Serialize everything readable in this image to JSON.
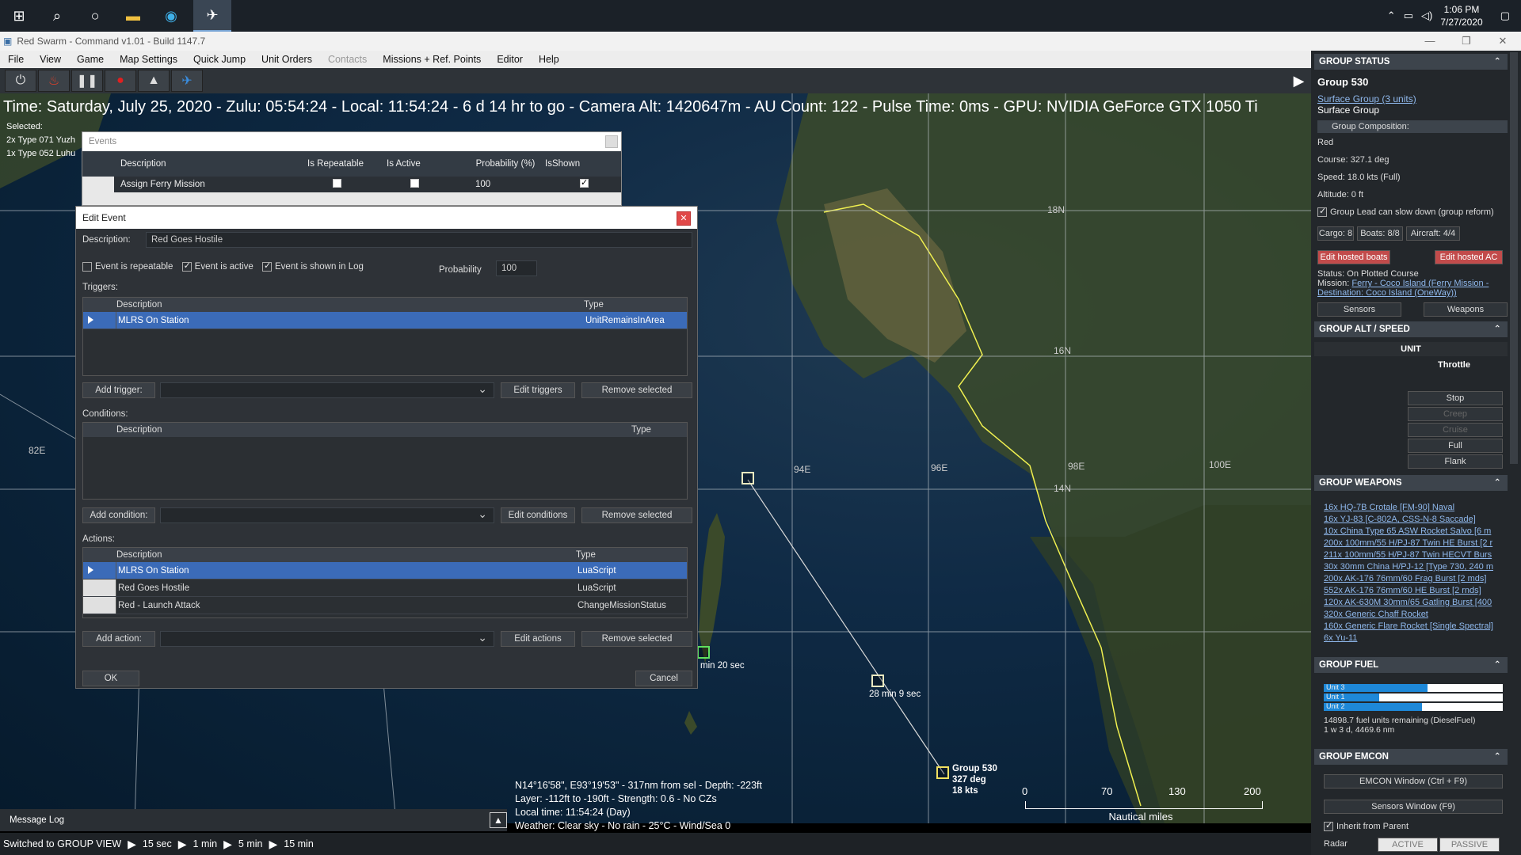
{
  "taskbar": {
    "time": "1:06 PM",
    "date": "7/27/2020"
  },
  "window": {
    "title": "Red Swarm - Command v1.01 - Build 1147.7"
  },
  "menu": [
    "File",
    "View",
    "Game",
    "Map Settings",
    "Quick Jump",
    "Unit Orders",
    "Contacts",
    "Missions + Ref. Points",
    "Editor",
    "Help"
  ],
  "infobar": "Time: Saturday, July 25, 2020 - Zulu: 05:54:24 - Local: 11:54:24 - 6 d 14 hr to go -  Camera Alt: 1420647m - AU Count: 122 - Pulse Time: 0ms - GPU: NVIDIA GeForce GTX 1050 Ti",
  "selected": {
    "label": "Selected:",
    "lines": [
      "2x Type 071 Yuzh",
      "1x Type 052 Luhu"
    ]
  },
  "map": {
    "lat_labels": [
      "18N",
      "16N",
      "14N",
      "82E",
      "94E",
      "96E",
      "98E",
      "100E"
    ],
    "unit_labels": {
      "eta1": "min 20 sec",
      "eta2": "28 min 9 sec",
      "group_name": "Group 530",
      "group_course": "327 deg",
      "group_speed": "18 kts"
    },
    "cursor_info": [
      "N14°16'58\", E93°19'53\" - 317nm from sel - Depth: -223ft",
      "Layer: -112ft to -190ft - Strength: 0.6 - No CZs",
      "Local time: 11:54:24 (Day)",
      "Weather: Clear sky - No rain - 25°C - Wind/Sea 0"
    ],
    "scale": {
      "ticks": [
        "0",
        "70",
        "130",
        "200"
      ],
      "unit": "Nautical miles"
    }
  },
  "events": {
    "title": "Events",
    "columns": [
      "Description",
      "Is Repeatable",
      "Is Active",
      "Probability (%)",
      "IsShown"
    ],
    "row": {
      "description": "Assign Ferry Mission",
      "probability": "100"
    }
  },
  "edit_event": {
    "title": "Edit Event",
    "description_label": "Description:",
    "description_value": "Red Goes Hostile",
    "repeatable_label": "Event is repeatable",
    "active_label": "Event is active",
    "shown_label": "Event is shown in Log",
    "probability_label": "Probability",
    "probability_value": "100",
    "triggers_label": "Triggers:",
    "conditions_label": "Conditions:",
    "actions_label": "Actions:",
    "col_description": "Description",
    "col_type": "Type",
    "triggers": [
      {
        "description": "MLRS On Station",
        "type": "UnitRemainsInArea"
      }
    ],
    "actions": [
      {
        "description": "MLRS On Station",
        "type": "LuaScript"
      },
      {
        "description": "Red Goes Hostile",
        "type": "LuaScript"
      },
      {
        "description": "Red - Launch Attack",
        "type": "ChangeMissionStatus"
      }
    ],
    "add_trigger": "Add trigger:",
    "edit_triggers": "Edit triggers",
    "add_condition": "Add condition:",
    "edit_conditions": "Edit conditions",
    "add_action": "Add action:",
    "edit_actions": "Edit actions",
    "remove_selected": "Remove selected",
    "ok": "OK",
    "cancel": "Cancel"
  },
  "message_log": "Message Log",
  "statusbar": {
    "text": "Switched to GROUP VIEW",
    "speeds": [
      "15 sec",
      "1 min",
      "5 min",
      "15 min"
    ]
  },
  "panel": {
    "group_status": "GROUP STATUS",
    "group_name": "Group 530",
    "surface_group_link": "Surface Group (3 units)",
    "surface_group": "Surface Group",
    "composition": "Group Composition:",
    "side": "Red",
    "course": "Course: 327.1 deg",
    "speed": "Speed: 18.0 kts (Full)",
    "altitude": "Altitude: 0 ft",
    "group_lead": "Group Lead can slow down (group reform)",
    "cargo": "Cargo: 8",
    "boats": "Boats: 8/8",
    "aircraft": "Aircraft: 4/4",
    "edit_boats": "Edit hosted boats",
    "edit_ac": "Edit hosted AC",
    "status": "Status: On Plotted Course",
    "mission_label": "Mission:",
    "mission_link": "Ferry - Coco Island (Ferry Mission - Destination: Coco Island (OneWay))",
    "sensors": "Sensors",
    "weapons": "Weapons",
    "alt_speed": "GROUP ALT / SPEED",
    "unit": "UNIT",
    "throttle": "Throttle",
    "throttle_options": [
      "Stop",
      "Creep",
      "Cruise",
      "Full",
      "Flank"
    ],
    "group_weapons": "GROUP WEAPONS",
    "weapon_list": [
      "16x HQ-7B Crotale [FM-90] Naval",
      "16x YJ-83 [C-802A, CSS-N-8 Saccade]",
      "10x China Type 65 ASW Rocket Salvo [6 m",
      "200x 100mm/55 H/PJ-87 Twin HE Burst [2 r",
      "211x 100mm/55 H/PJ-87 Twin HECVT Burs",
      "30x 30mm China H/PJ-12 [Type 730, 240 m",
      "200x AK-176 76mm/60 Frag Burst [2 mds]",
      "552x AK-176 76mm/60 HE Burst [2 rnds]",
      "120x AK-630M 30mm/65 Gatling Burst [400",
      "320x Generic Chaff Rocket",
      "160x Generic Flare Rocket [Single Spectral]",
      "6x Yu-11"
    ],
    "group_fuel": "GROUP FUEL",
    "fuel_units": [
      {
        "name": "Unit 3",
        "level": 0.58
      },
      {
        "name": "Unit 1",
        "level": 0.31
      },
      {
        "name": "Unit 2",
        "level": 0.55
      }
    ],
    "fuel_remaining": "14898.7 fuel units remaining (DieselFuel)",
    "fuel_range": "1 w 3 d, 4469.6 nm",
    "group_emcon": "GROUP EMCON",
    "emcon_window": "EMCON Window (Ctrl + F9)",
    "sensors_window": "Sensors Window (F9)",
    "inherit": "Inherit from Parent",
    "radar": "Radar",
    "active": "ACTIVE",
    "passive": "PASSIVE"
  }
}
